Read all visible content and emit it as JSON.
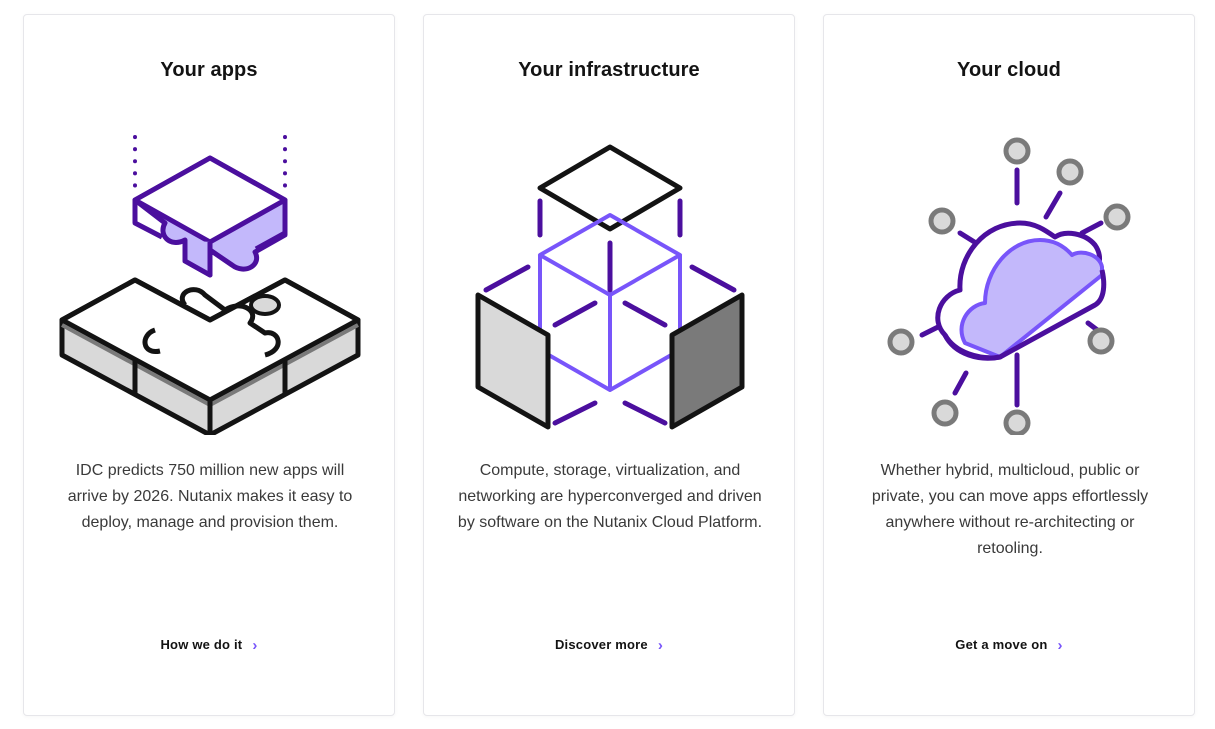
{
  "colors": {
    "accent": "#7855fa",
    "dark_purple": "#4b0f9e",
    "light_purple": "#c3b8fb",
    "stroke_dark": "#131313",
    "gray_fill": "#d9d9d9",
    "dark_gray_fill": "#7a7a7a"
  },
  "cards": [
    {
      "title": "Your apps",
      "illustration_icon": "puzzle-pieces-icon",
      "description": "IDC predicts 750 million new apps will arrive by 2026. Nutanix makes it easy to deploy, manage and provision them.",
      "link_label": "How we do it",
      "link_icon": "chevron-right-icon"
    },
    {
      "title": "Your infrastructure",
      "illustration_icon": "hyperconverged-cube-icon",
      "description": "Compute, storage, virtualization, and networking are hyperconverged and driven by software on the Nutanix Cloud Platform.",
      "link_label": "Discover more",
      "link_icon": "chevron-right-icon"
    },
    {
      "title": "Your cloud",
      "illustration_icon": "cloud-network-icon",
      "description": "Whether hybrid, multicloud, public or private, you can move apps effortlessly anywhere without re-architecting or retooling.",
      "link_label": "Get a move on",
      "link_icon": "chevron-right-icon"
    }
  ]
}
